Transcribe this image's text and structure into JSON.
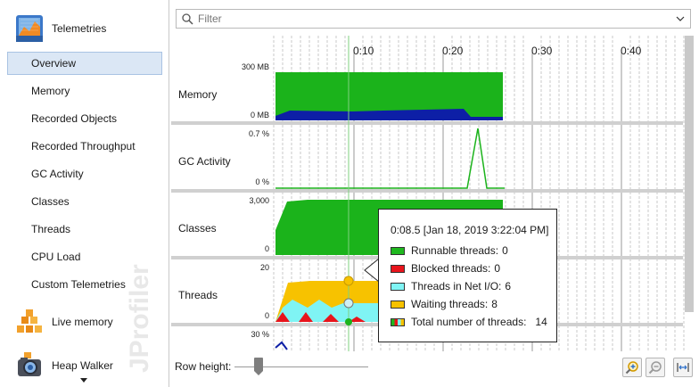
{
  "sidebar": {
    "telemetries": {
      "label": "Telemetries",
      "icon": "telemetries-icon"
    },
    "items": [
      {
        "label": "Overview",
        "selected": true
      },
      {
        "label": "Memory"
      },
      {
        "label": "Recorded Objects"
      },
      {
        "label": "Recorded Throughput"
      },
      {
        "label": "GC Activity"
      },
      {
        "label": "Classes"
      },
      {
        "label": "Threads"
      },
      {
        "label": "CPU Load"
      },
      {
        "label": "Custom Telemetries"
      }
    ],
    "live_memory": {
      "label": "Live memory",
      "icon": "live-memory-icon"
    },
    "heap_walker": {
      "label": "Heap Walker",
      "icon": "heap-walker-icon"
    },
    "watermark": "JProfiler"
  },
  "filter": {
    "placeholder": "Filter"
  },
  "timeline": {
    "ticks": [
      "0:10",
      "0:20",
      "0:30",
      "0:40"
    ]
  },
  "rows": {
    "memory": {
      "label": "Memory",
      "max": "300 MB",
      "min": "0 MB"
    },
    "gc": {
      "label": "GC Activity",
      "max": "0.7 %",
      "min": "0 %"
    },
    "classes": {
      "label": "Classes",
      "max": "3,000",
      "min": "0"
    },
    "threads": {
      "label": "Threads",
      "max": "20",
      "min": "0"
    },
    "cpu": {
      "max": "30 %"
    }
  },
  "tooltip": {
    "title": "0:08.5 [Jan 18, 2019 3:22:04 PM]",
    "rows": [
      {
        "label": "Runnable threads:",
        "value": "0",
        "color": "#1fb81f"
      },
      {
        "label": "Blocked threads:",
        "value": "0",
        "color": "#e8141c"
      },
      {
        "label": "Threads in Net I/O:",
        "value": "6",
        "color": "#7ff4f4"
      },
      {
        "label": "Waiting threads:",
        "value": "8",
        "color": "#f7c200"
      },
      {
        "label": "Total number of threads:",
        "value": "14",
        "color": "multi"
      }
    ]
  },
  "bottom": {
    "row_height_label": "Row height:"
  },
  "colors": {
    "green": "#1bb31b",
    "navy": "#0d1fa6",
    "red": "#e8141c",
    "cyan": "#7ff4f4",
    "yellow": "#f7c200",
    "selection": "#dbe7f5"
  }
}
